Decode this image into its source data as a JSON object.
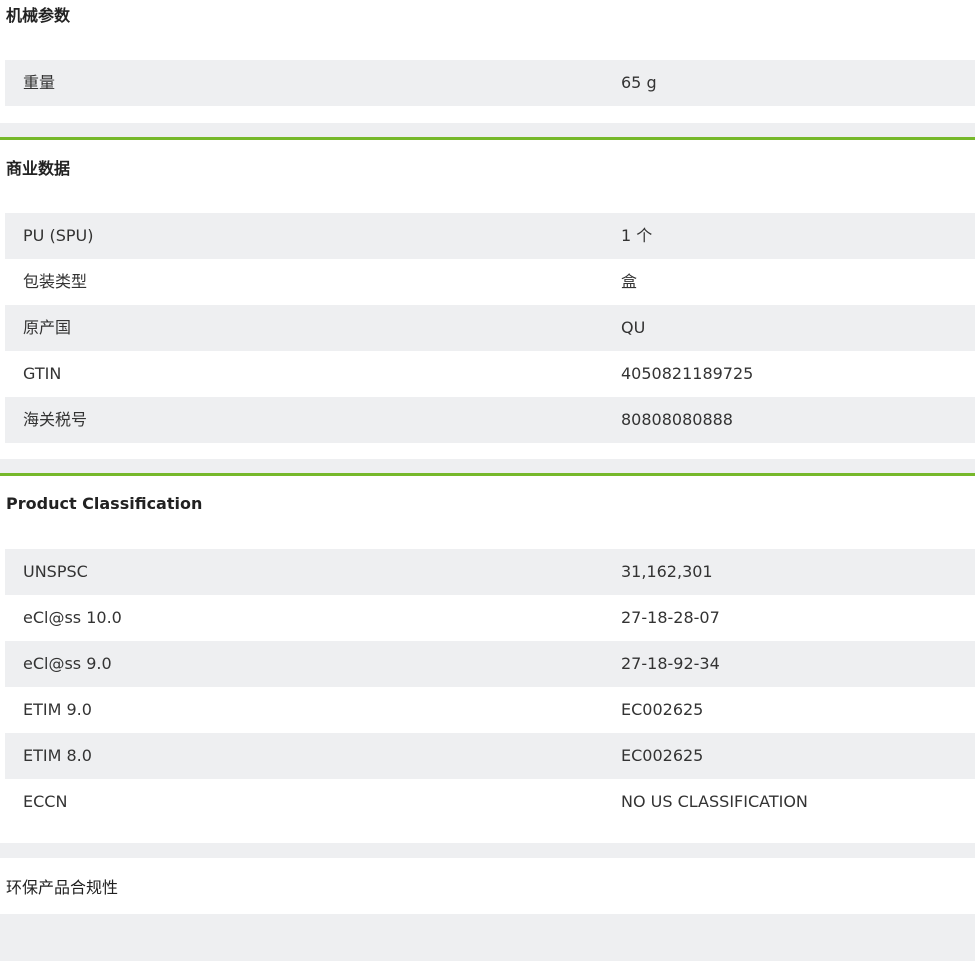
{
  "mechanical": {
    "title": "机械参数",
    "rows": [
      {
        "label": "重量",
        "value": "65 g"
      }
    ]
  },
  "commercial": {
    "title": "商业数据",
    "rows": [
      {
        "label": "PU (SPU)",
        "value": "1 个"
      },
      {
        "label": "包装类型",
        "value": "盒"
      },
      {
        "label": "原产国",
        "value": "QU"
      },
      {
        "label": "GTIN",
        "value": "4050821189725"
      },
      {
        "label": "海关税号",
        "value": "80808080888"
      }
    ]
  },
  "classification": {
    "title": "Product Classification",
    "rows": [
      {
        "label": "UNSPSC",
        "value": "31,162,301"
      },
      {
        "label": "eCl@ss 10.0",
        "value": "27-18-28-07"
      },
      {
        "label": "eCl@ss 9.0",
        "value": "27-18-92-34"
      },
      {
        "label": "ETIM 9.0",
        "value": "EC002625"
      },
      {
        "label": "ETIM 8.0",
        "value": "EC002625"
      },
      {
        "label": "ECCN",
        "value": "NO US CLASSIFICATION"
      }
    ]
  },
  "environmental": {
    "title": "环保产品合规性"
  },
  "colors": {
    "accent": "#76b82a",
    "row_shade": "#eeeff1"
  }
}
